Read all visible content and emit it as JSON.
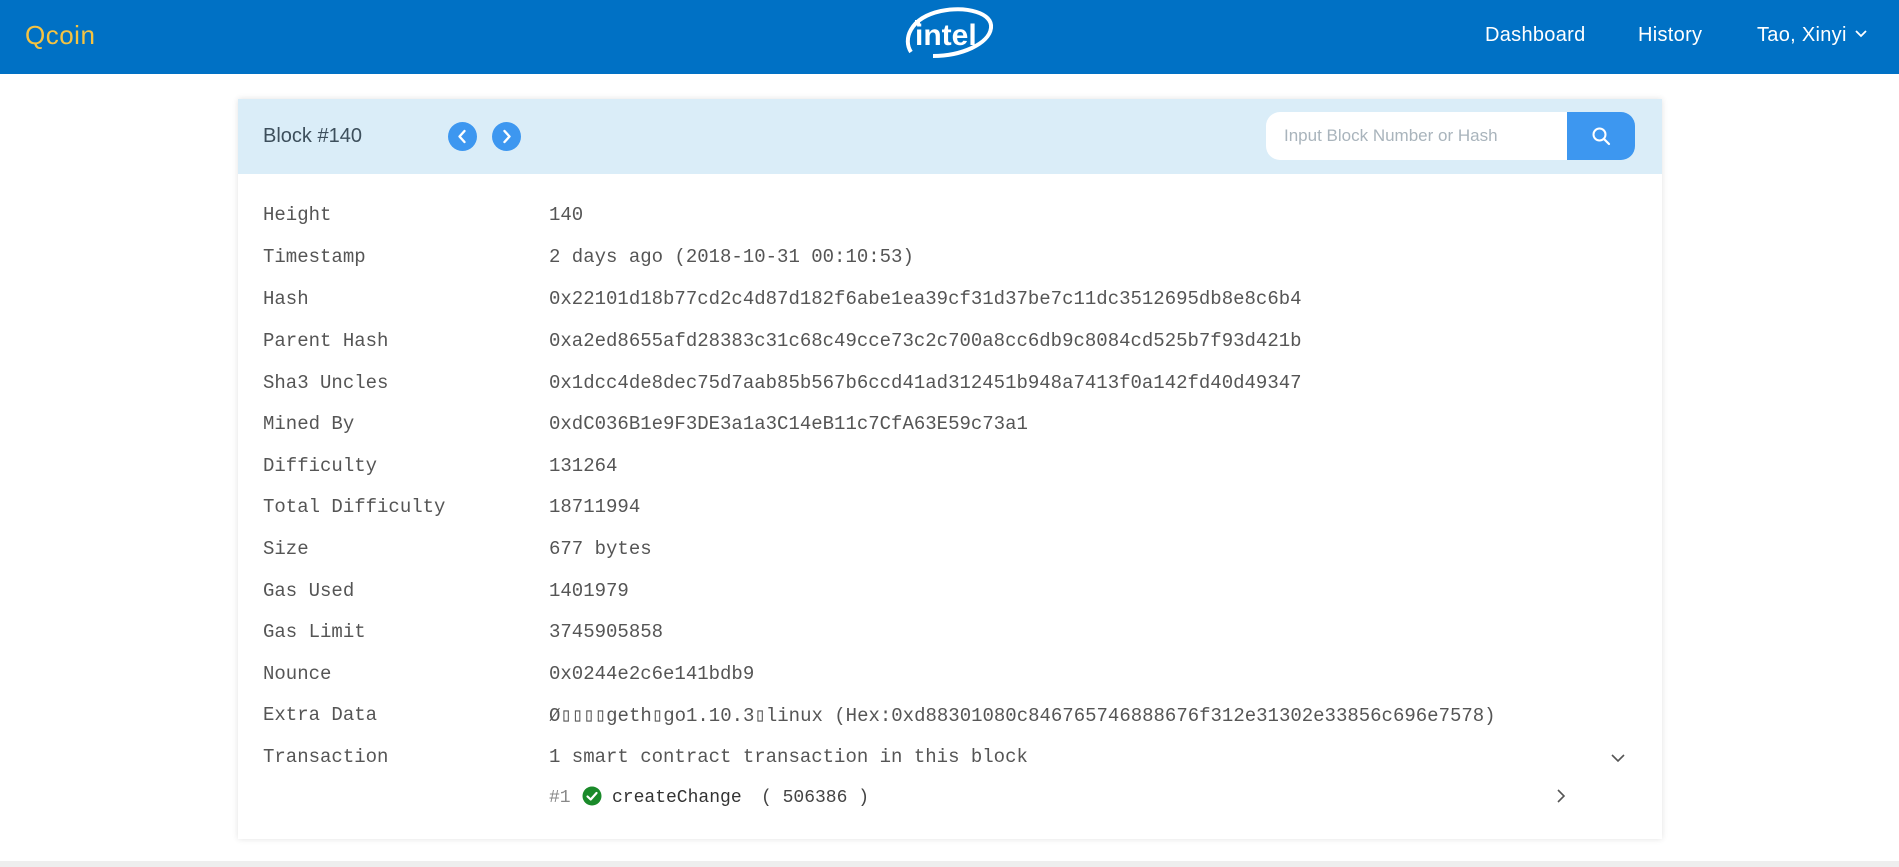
{
  "header": {
    "brand": "Qcoin",
    "logo_icon": "intel-logo-icon",
    "nav": {
      "dashboard": "Dashboard",
      "history": "History",
      "user": "Tao, Xinyi"
    },
    "colors": {
      "bar": "#0071c5",
      "brand": "#f5c342"
    }
  },
  "block_panel": {
    "title": "Block #140",
    "search": {
      "placeholder": "Input Block Number or Hash"
    },
    "colors": {
      "head": "#daedf8",
      "accent": "#3d97f0"
    }
  },
  "details": [
    {
      "label": "Height",
      "value": "140"
    },
    {
      "label": "Timestamp",
      "value": "2 days ago (2018-10-31 00:10:53)"
    },
    {
      "label": "Hash",
      "value": "0x22101d18b77cd2c4d87d182f6abe1ea39cf31d37be7c11dc3512695db8e8c6b4"
    },
    {
      "label": "Parent Hash",
      "value": "0xa2ed8655afd28383c31c68c49cce73c2c700a8cc6db9c8084cd525b7f93d421b"
    },
    {
      "label": "Sha3 Uncles",
      "value": "0x1dcc4de8dec75d7aab85b567b6ccd41ad312451b948a7413f0a142fd40d49347"
    },
    {
      "label": "Mined By",
      "value": "0xdC036B1e9F3DE3a1a3C14eB11c7CfA63E59c73a1"
    },
    {
      "label": "Difficulty",
      "value": "131264"
    },
    {
      "label": "Total Difficulty",
      "value": "18711994"
    },
    {
      "label": "Size",
      "value": "677 bytes"
    },
    {
      "label": "Gas Used",
      "value": "1401979"
    },
    {
      "label": "Gas Limit",
      "value": "3745905858"
    },
    {
      "label": "Nounce",
      "value": "0x0244e2c6e141bdb9"
    },
    {
      "label": "Extra Data",
      "value": "Ø▯▯▯▯geth▯go1.10.3▯linux (Hex:0xd88301080c846765746888676f312e31302e33856c696e7578)"
    },
    {
      "label": "Transaction",
      "value": "1 smart contract transaction in this block"
    }
  ],
  "transactions": [
    {
      "index": "#1",
      "status": "success",
      "name": "createChange",
      "args": "( 506386 )"
    }
  ]
}
